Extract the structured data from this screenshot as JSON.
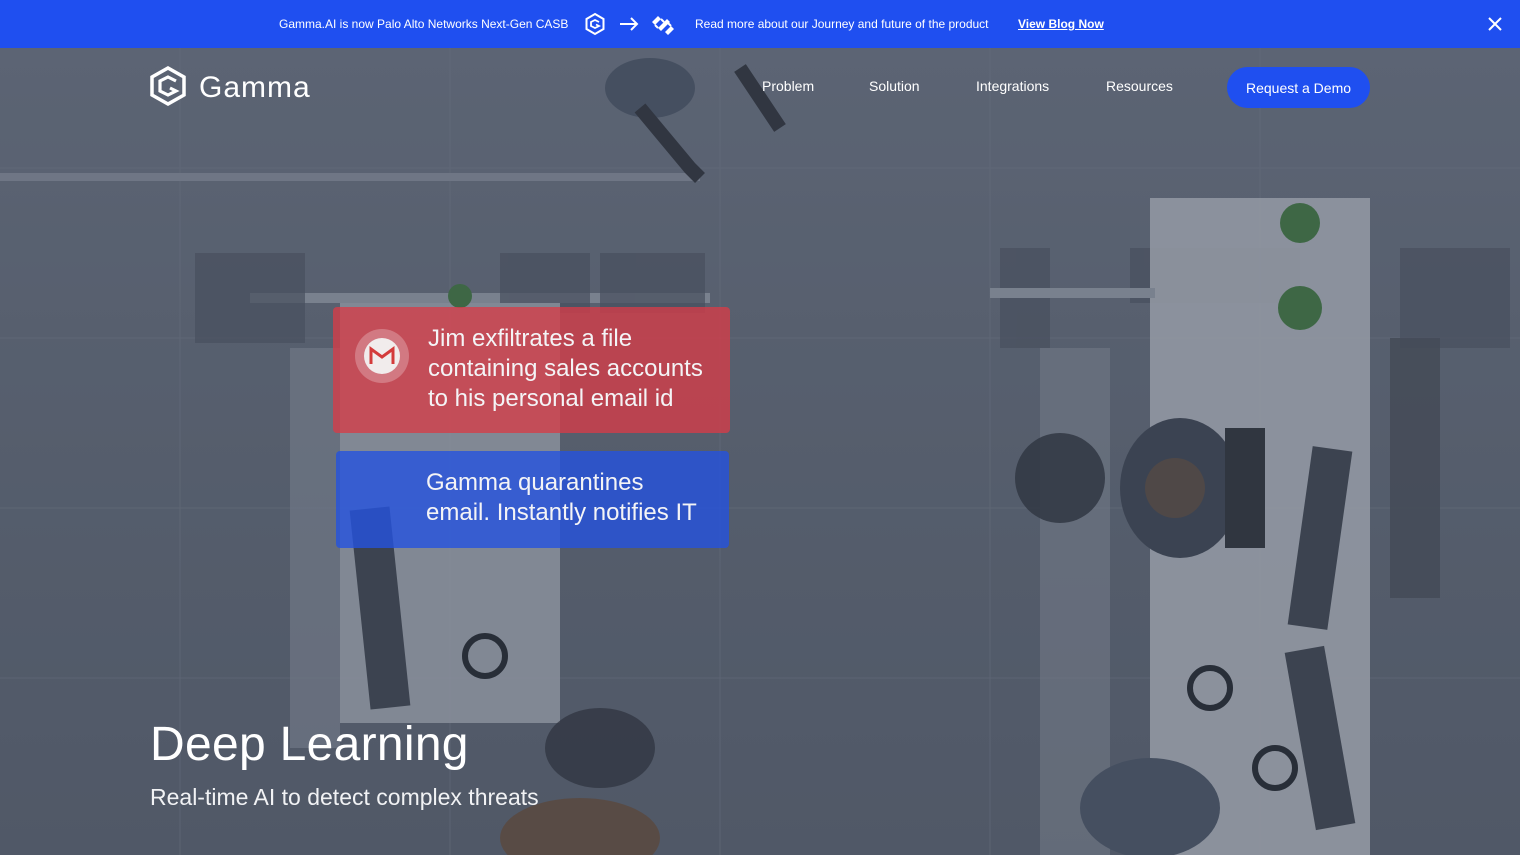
{
  "announcement": {
    "text": "Gamma.AI is now Palo Alto Networks Next-Gen CASB",
    "secondary_text": "Read more about our Journey and future of the product",
    "link_label": "View Blog Now",
    "icons": [
      "gamma-logo-icon",
      "arrow-right-icon",
      "palo-alto-logo-icon",
      "close-icon"
    ],
    "background_color": "#1f4ff0"
  },
  "header": {
    "brand": "Gamma",
    "nav": [
      {
        "label": "Problem"
      },
      {
        "label": "Solution"
      },
      {
        "label": "Integrations"
      },
      {
        "label": "Resources"
      }
    ],
    "cta_label": "Request a Demo",
    "cta_color": "#1f4ff0"
  },
  "hero": {
    "alert_card": {
      "line1": "Jim exfiltrates a file",
      "line2": "containing sales accounts",
      "line3": "to his personal email id",
      "icon": "gmail-icon",
      "color": "#d63c48"
    },
    "action_card": {
      "line1": "Gamma quarantines",
      "line2": "email. Instantly notifies IT",
      "color": "#2452de"
    },
    "title": "Deep Learning",
    "subtitle": "Real-time AI to detect complex threats"
  }
}
